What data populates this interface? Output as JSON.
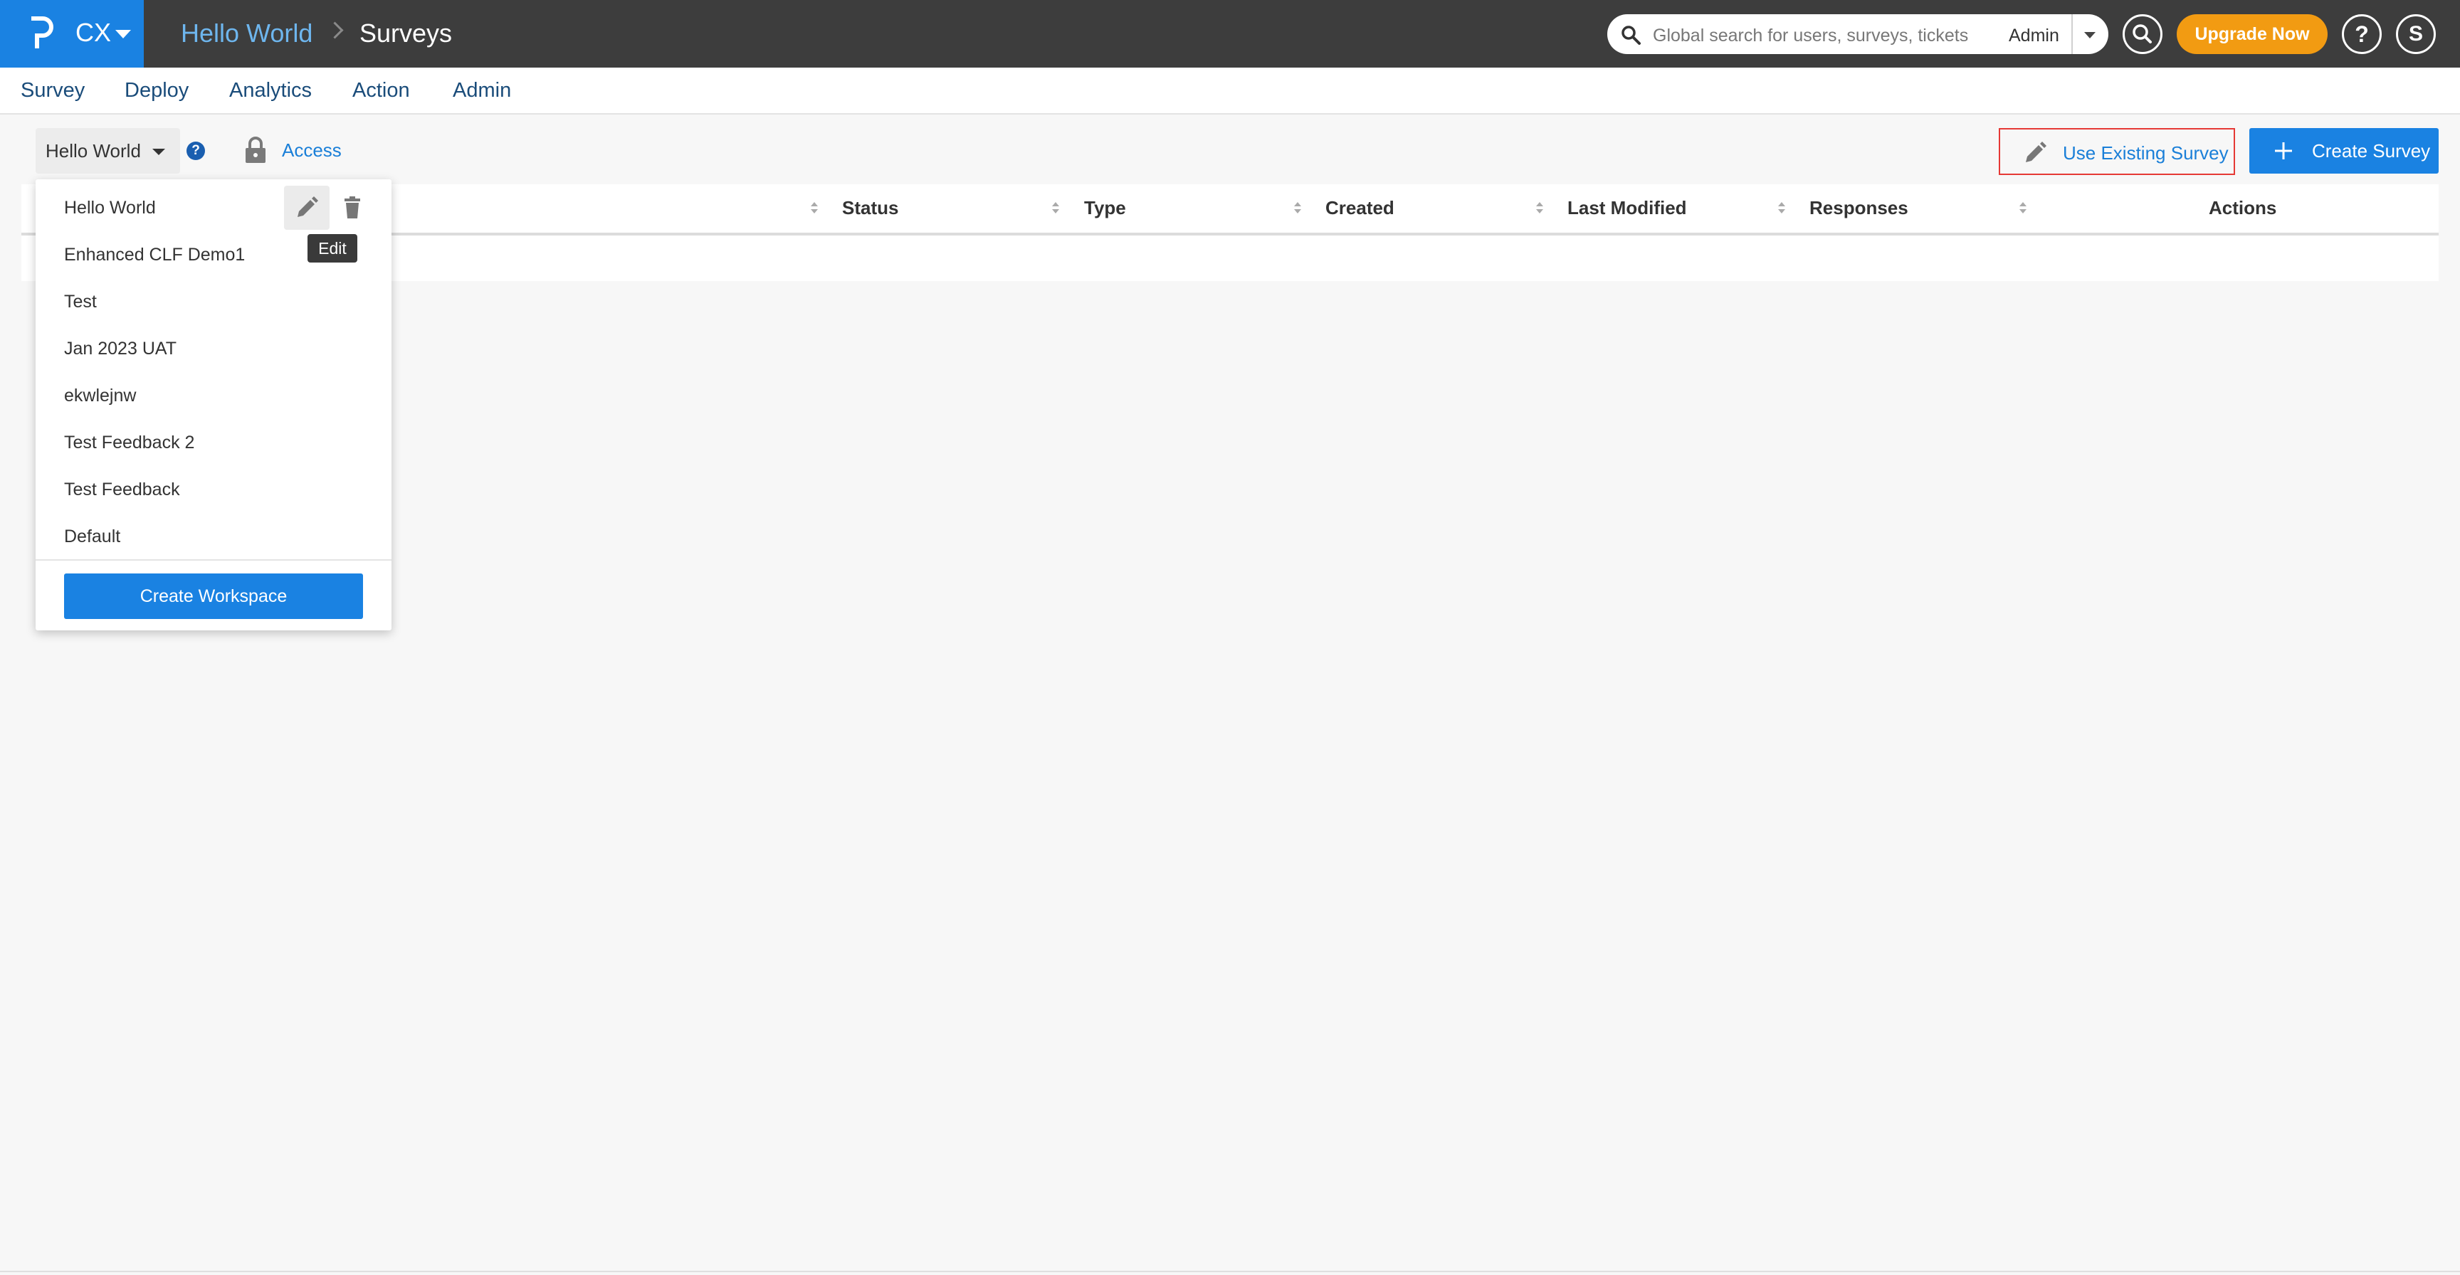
{
  "app": {
    "product": "CX",
    "breadcrumb": [
      "Hello World",
      "Surveys"
    ]
  },
  "search": {
    "placeholder": "Global search for users, surveys, tickets",
    "scope": "Admin"
  },
  "header_actions": {
    "upgrade_label": "Upgrade Now",
    "help_label": "?",
    "user_initial": "S"
  },
  "nav": {
    "items": [
      "Survey",
      "Deploy",
      "Analytics",
      "Action",
      "Admin"
    ]
  },
  "toolbar": {
    "workspace": "Hello World",
    "help": "?",
    "access_label": "Access",
    "use_existing_label": "Use Existing Survey",
    "create_survey_label": "Create Survey"
  },
  "table": {
    "columns": [
      "Status",
      "Type",
      "Created",
      "Last Modified",
      "Responses",
      "Actions"
    ]
  },
  "workspace_dropdown": {
    "items": [
      "Hello World",
      "Enhanced CLF Demo1",
      "Test",
      "Jan 2023 UAT",
      "ekwlejnw",
      "Test Feedback 2",
      "Test Feedback",
      "Default"
    ],
    "tooltip": "Edit",
    "create_label": "Create Workspace"
  },
  "colors": {
    "topbar": "#3d3d3d",
    "brand": "#1a82e2",
    "upgrade": "#f29b12",
    "link": "#1a7fd8",
    "highlight_border": "#e53935"
  }
}
